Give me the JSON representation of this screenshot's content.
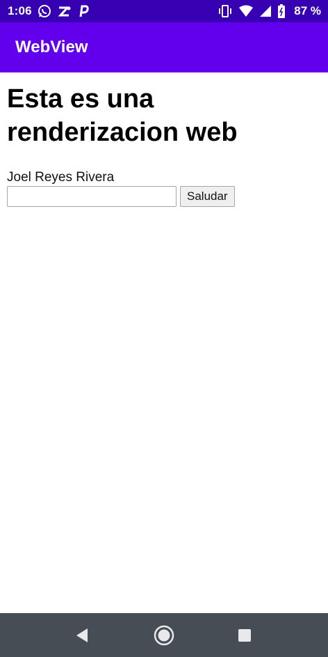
{
  "status_bar": {
    "time": "1:06",
    "battery": "87 %",
    "icons": [
      "whatsapp-icon",
      "zoom-app-icon",
      "paypal-icon",
      "vibrate-icon",
      "wifi-icon",
      "signal-icon",
      "battery-icon"
    ]
  },
  "app_bar": {
    "title": "WebView",
    "color": "#6200ee"
  },
  "web": {
    "heading": "Esta es una renderizacion web",
    "name": "Joel Reyes Rivera",
    "input_value": "",
    "button_label": "Saludar"
  },
  "nav_bar": {
    "icons": [
      "back-icon",
      "home-icon",
      "recents-icon"
    ]
  }
}
